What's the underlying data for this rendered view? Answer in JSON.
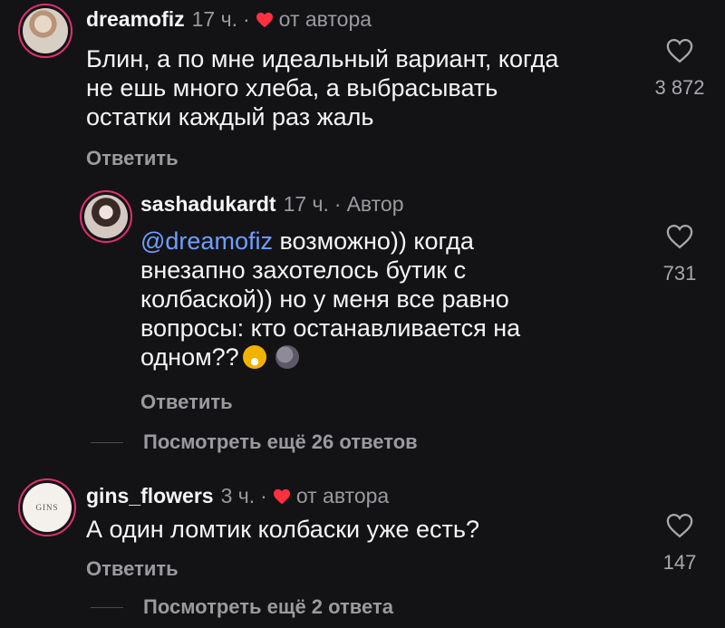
{
  "comments": [
    {
      "username": "dreamofiz",
      "time": "17 ч.",
      "dot": "·",
      "author_liked": "от автора",
      "lines": [
        "Блин, а по мне идеальный вариант, когда",
        "не ешь много хлеба, а выбрасывать",
        "остатки каждый раз жаль"
      ],
      "reply_label": "Ответить",
      "likes": "3 872"
    },
    {
      "username": "sashadukardt",
      "time": "17 ч.",
      "dot": "·",
      "author_tag": "Автор",
      "mention": "@dreamofiz",
      "lines": [
        "возможно)) когда",
        "внезапно захотелось бутик с",
        "колбаской)) но у меня все равно",
        "вопросы: кто останавливается на",
        "одном??"
      ],
      "reply_label": "Ответить",
      "likes": "731"
    },
    {
      "username": "gins_flowers",
      "time": "3 ч.",
      "dot": "·",
      "author_liked": "от автора",
      "lines": [
        "А один ломтик колбаски уже есть?"
      ],
      "reply_label": "Ответить",
      "likes": "147",
      "avatar_text": "GINS"
    }
  ],
  "view_more": [
    {
      "label": "Посмотреть ещё 26 ответов"
    },
    {
      "label": "Посмотреть ещё 2 ответа"
    }
  ],
  "colors": {
    "background": "#131316",
    "heart_red": "#ff3040",
    "mention_blue": "#6f9fff",
    "secondary_text": "#9a9a9f"
  },
  "icons": {
    "like": "heart-outline-icon",
    "author_like": "heart-filled-icon",
    "emoji_1": "grinning-face-emoji",
    "emoji_2": "new-moon-face-emoji"
  }
}
